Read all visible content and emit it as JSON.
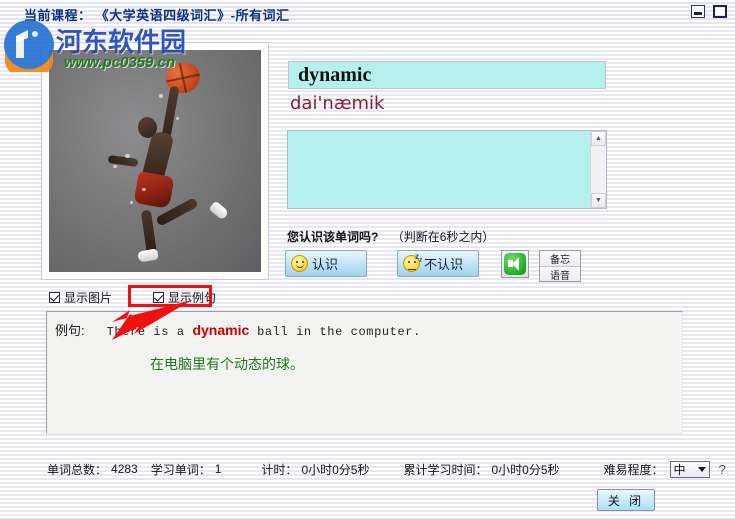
{
  "titlebar": {
    "label": "当前课程：",
    "course": "《大学英语四级词汇》-所有词汇",
    "minimize_icon": "minimize-icon",
    "maximize_icon": "maximize-icon"
  },
  "watermark": {
    "site_name": "河东软件园",
    "url": "www.pc0359.cn"
  },
  "photo": {
    "alt": "basketball-player-dunking"
  },
  "word": {
    "text": "dynamic",
    "phonetic": "dai'næmik",
    "meaning_value": "",
    "meaning_placeholder": ""
  },
  "quiz": {
    "question": "您认识该单词吗?",
    "note": "（判断在6秒之内）",
    "know_label": "认识",
    "dont_know_label": "不认识",
    "speaker_icon": "speaker-icon",
    "memo_label": "备忘",
    "voice_label": "语音"
  },
  "options": {
    "show_picture_label": "显示图片",
    "show_picture_checked": true,
    "show_example_label": "显示例句",
    "show_example_checked": true
  },
  "example": {
    "label": "例句:",
    "sentence_before": "There is a ",
    "sentence_highlight": "dynamic",
    "sentence_after": " ball in the computer.",
    "translation": "在电脑里有个动态的球。"
  },
  "status": {
    "total_label": "单词总数：",
    "total_value": "4283",
    "studied_label": "学习单词：",
    "studied_value": "1",
    "timer_label": "计时：",
    "timer_value": "0小时0分5秒",
    "cumulative_label": "累计学习时间：",
    "cumulative_value": "0小时0分5秒",
    "difficulty_label": "难易程度：",
    "difficulty_value": "中",
    "help_label": "?"
  },
  "footer": {
    "close_label": "关 闭"
  },
  "colors": {
    "word_bg": "#b4f0ee",
    "phonetic": "#8a2030",
    "highlight": "#cc0000",
    "translation": "#1b7a1b",
    "annotation": "#ee1111",
    "title": "#0b2f8a"
  }
}
